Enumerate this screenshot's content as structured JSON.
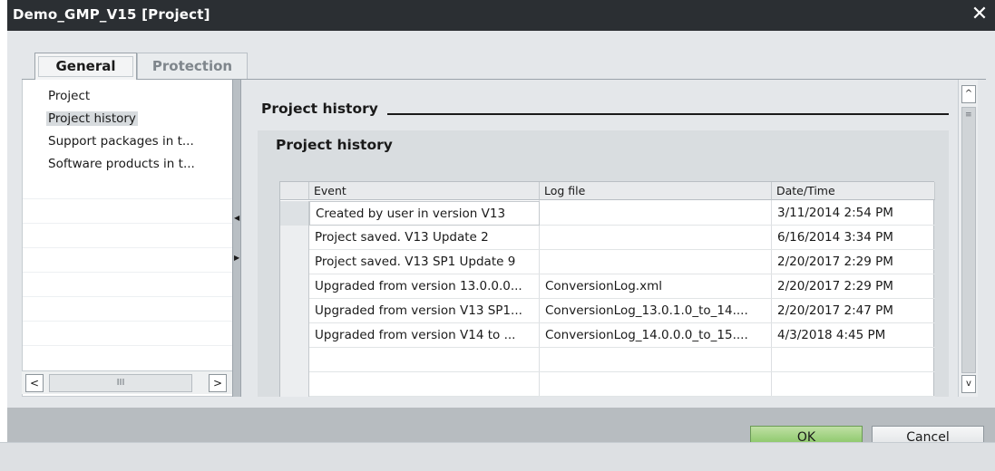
{
  "window": {
    "title": "Demo_GMP_V15 [Project]",
    "close_glyph": "✕"
  },
  "tabs": [
    {
      "label": "General",
      "active": true
    },
    {
      "label": "Protection",
      "active": false
    }
  ],
  "nav": {
    "items": [
      {
        "label": "Project"
      },
      {
        "label": "Project history",
        "selected": true
      },
      {
        "label": "Support packages in t..."
      },
      {
        "label": "Software products in t..."
      }
    ],
    "scroll_left": "<",
    "scroll_right": ">",
    "thumb_grip": "III"
  },
  "section": {
    "title": "Project history",
    "subtitle": "Project history"
  },
  "table": {
    "columns": [
      "Event",
      "Log file",
      "Date/Time"
    ],
    "rows": [
      {
        "event": "Created by user in version V13",
        "log": "",
        "date": "3/11/2014 2:54 PM"
      },
      {
        "event": "Project saved. V13 Update 2",
        "log": "",
        "date": "6/16/2014 3:34 PM"
      },
      {
        "event": "Project saved. V13 SP1 Update 9",
        "log": "",
        "date": "2/20/2017 2:29 PM"
      },
      {
        "event": "Upgraded from version 13.0.0.0...",
        "log": "ConversionLog.xml",
        "date": "2/20/2017 2:29 PM"
      },
      {
        "event": "Upgraded from version V13 SP1...",
        "log": "ConversionLog_13.0.1.0_to_14....",
        "date": "2/20/2017 2:47 PM"
      },
      {
        "event": "Upgraded from version V14 to ...",
        "log": "ConversionLog_14.0.0.0_to_15....",
        "date": "4/3/2018 4:45 PM"
      },
      {
        "event": "",
        "log": "",
        "date": ""
      },
      {
        "event": "",
        "log": "",
        "date": ""
      }
    ]
  },
  "vscroll": {
    "up": "^",
    "down": "v",
    "grip": "≡"
  },
  "buttons": {
    "ok": "OK",
    "cancel": "Cancel"
  },
  "colors": {
    "title_bar": "#2b2f33",
    "ok_button": "#7ec15a",
    "selection": "#d7dbde"
  }
}
